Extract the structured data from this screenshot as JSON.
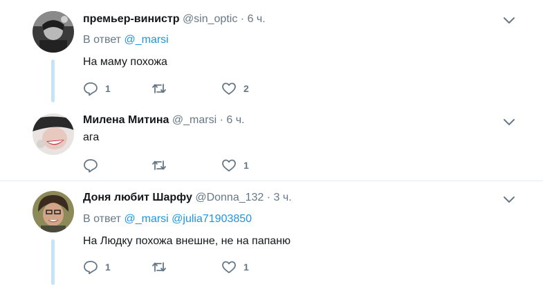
{
  "tweets": [
    {
      "name": "премьер-винистр",
      "handle": "@sin_optic",
      "dot": "·",
      "time": "6 ч.",
      "replying_label": "В ответ",
      "mentions": [
        "@_marsi"
      ],
      "text": "На маму похожа",
      "reply_count": "1",
      "retweet_count": "",
      "like_count": "2"
    },
    {
      "name": "Милена Митина",
      "handle": "@_marsi",
      "dot": "·",
      "time": "6 ч.",
      "text": "ага",
      "reply_count": "",
      "retweet_count": "",
      "like_count": "1"
    },
    {
      "name": "Доня любит Шарфу",
      "handle": "@Donna_132",
      "dot": "·",
      "time": "3 ч.",
      "replying_label": "В ответ",
      "mentions": [
        "@_marsi",
        "@julia71903850"
      ],
      "text": "На Людку похожа внешне, не на папаню",
      "reply_count": "1",
      "retweet_count": "",
      "like_count": "1"
    }
  ],
  "colors": {
    "link": "#1b95e0",
    "muted": "#657786",
    "thread_line": "#c4e4f7",
    "separator": "#e6ecf0"
  },
  "icons": [
    "reply-icon",
    "retweet-icon",
    "like-icon",
    "chevron-down-icon"
  ]
}
